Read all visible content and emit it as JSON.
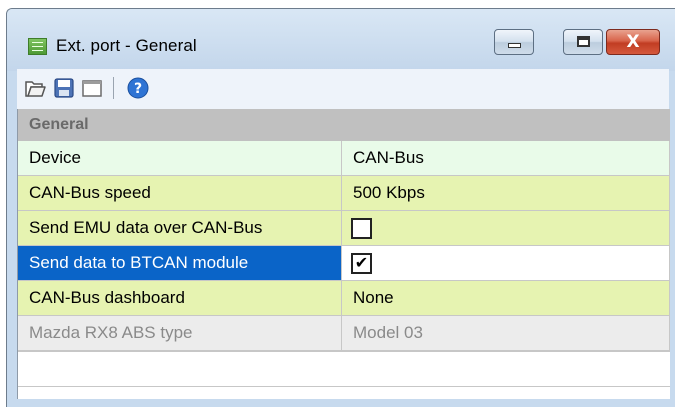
{
  "window": {
    "title": "Ext. port - General",
    "close_glyph": "X",
    "colors": {
      "frame": "#c7daee",
      "close_button": "#c13d23"
    }
  },
  "toolbar": {
    "buttons": [
      {
        "icon": "open-folder-icon"
      },
      {
        "icon": "save-icon"
      },
      {
        "icon": "window-icon"
      },
      {
        "icon": "help-icon"
      }
    ]
  },
  "property_grid": {
    "category": "General",
    "rows": [
      {
        "name": "Device",
        "value": "CAN-Bus",
        "state": "normal",
        "bg": "#e9fbe9"
      },
      {
        "name": "CAN-Bus speed",
        "value": "500 Kbps",
        "state": "normal",
        "bg": "#e6f3b1"
      },
      {
        "name": "Send EMU data over CAN-Bus",
        "value": "",
        "checkbox": false,
        "state": "normal",
        "bg": "#e6f3b1"
      },
      {
        "name": "Send data to BTCAN module",
        "value": "",
        "checkbox": true,
        "check_glyph": "✔",
        "state": "selected",
        "bg": "#0a64c8"
      },
      {
        "name": "CAN-Bus dashboard",
        "value": "None",
        "state": "normal",
        "bg": "#e6f3b1"
      },
      {
        "name": "Mazda RX8 ABS type",
        "value": "Model 03",
        "state": "disabled",
        "bg": "#ececec"
      }
    ]
  }
}
